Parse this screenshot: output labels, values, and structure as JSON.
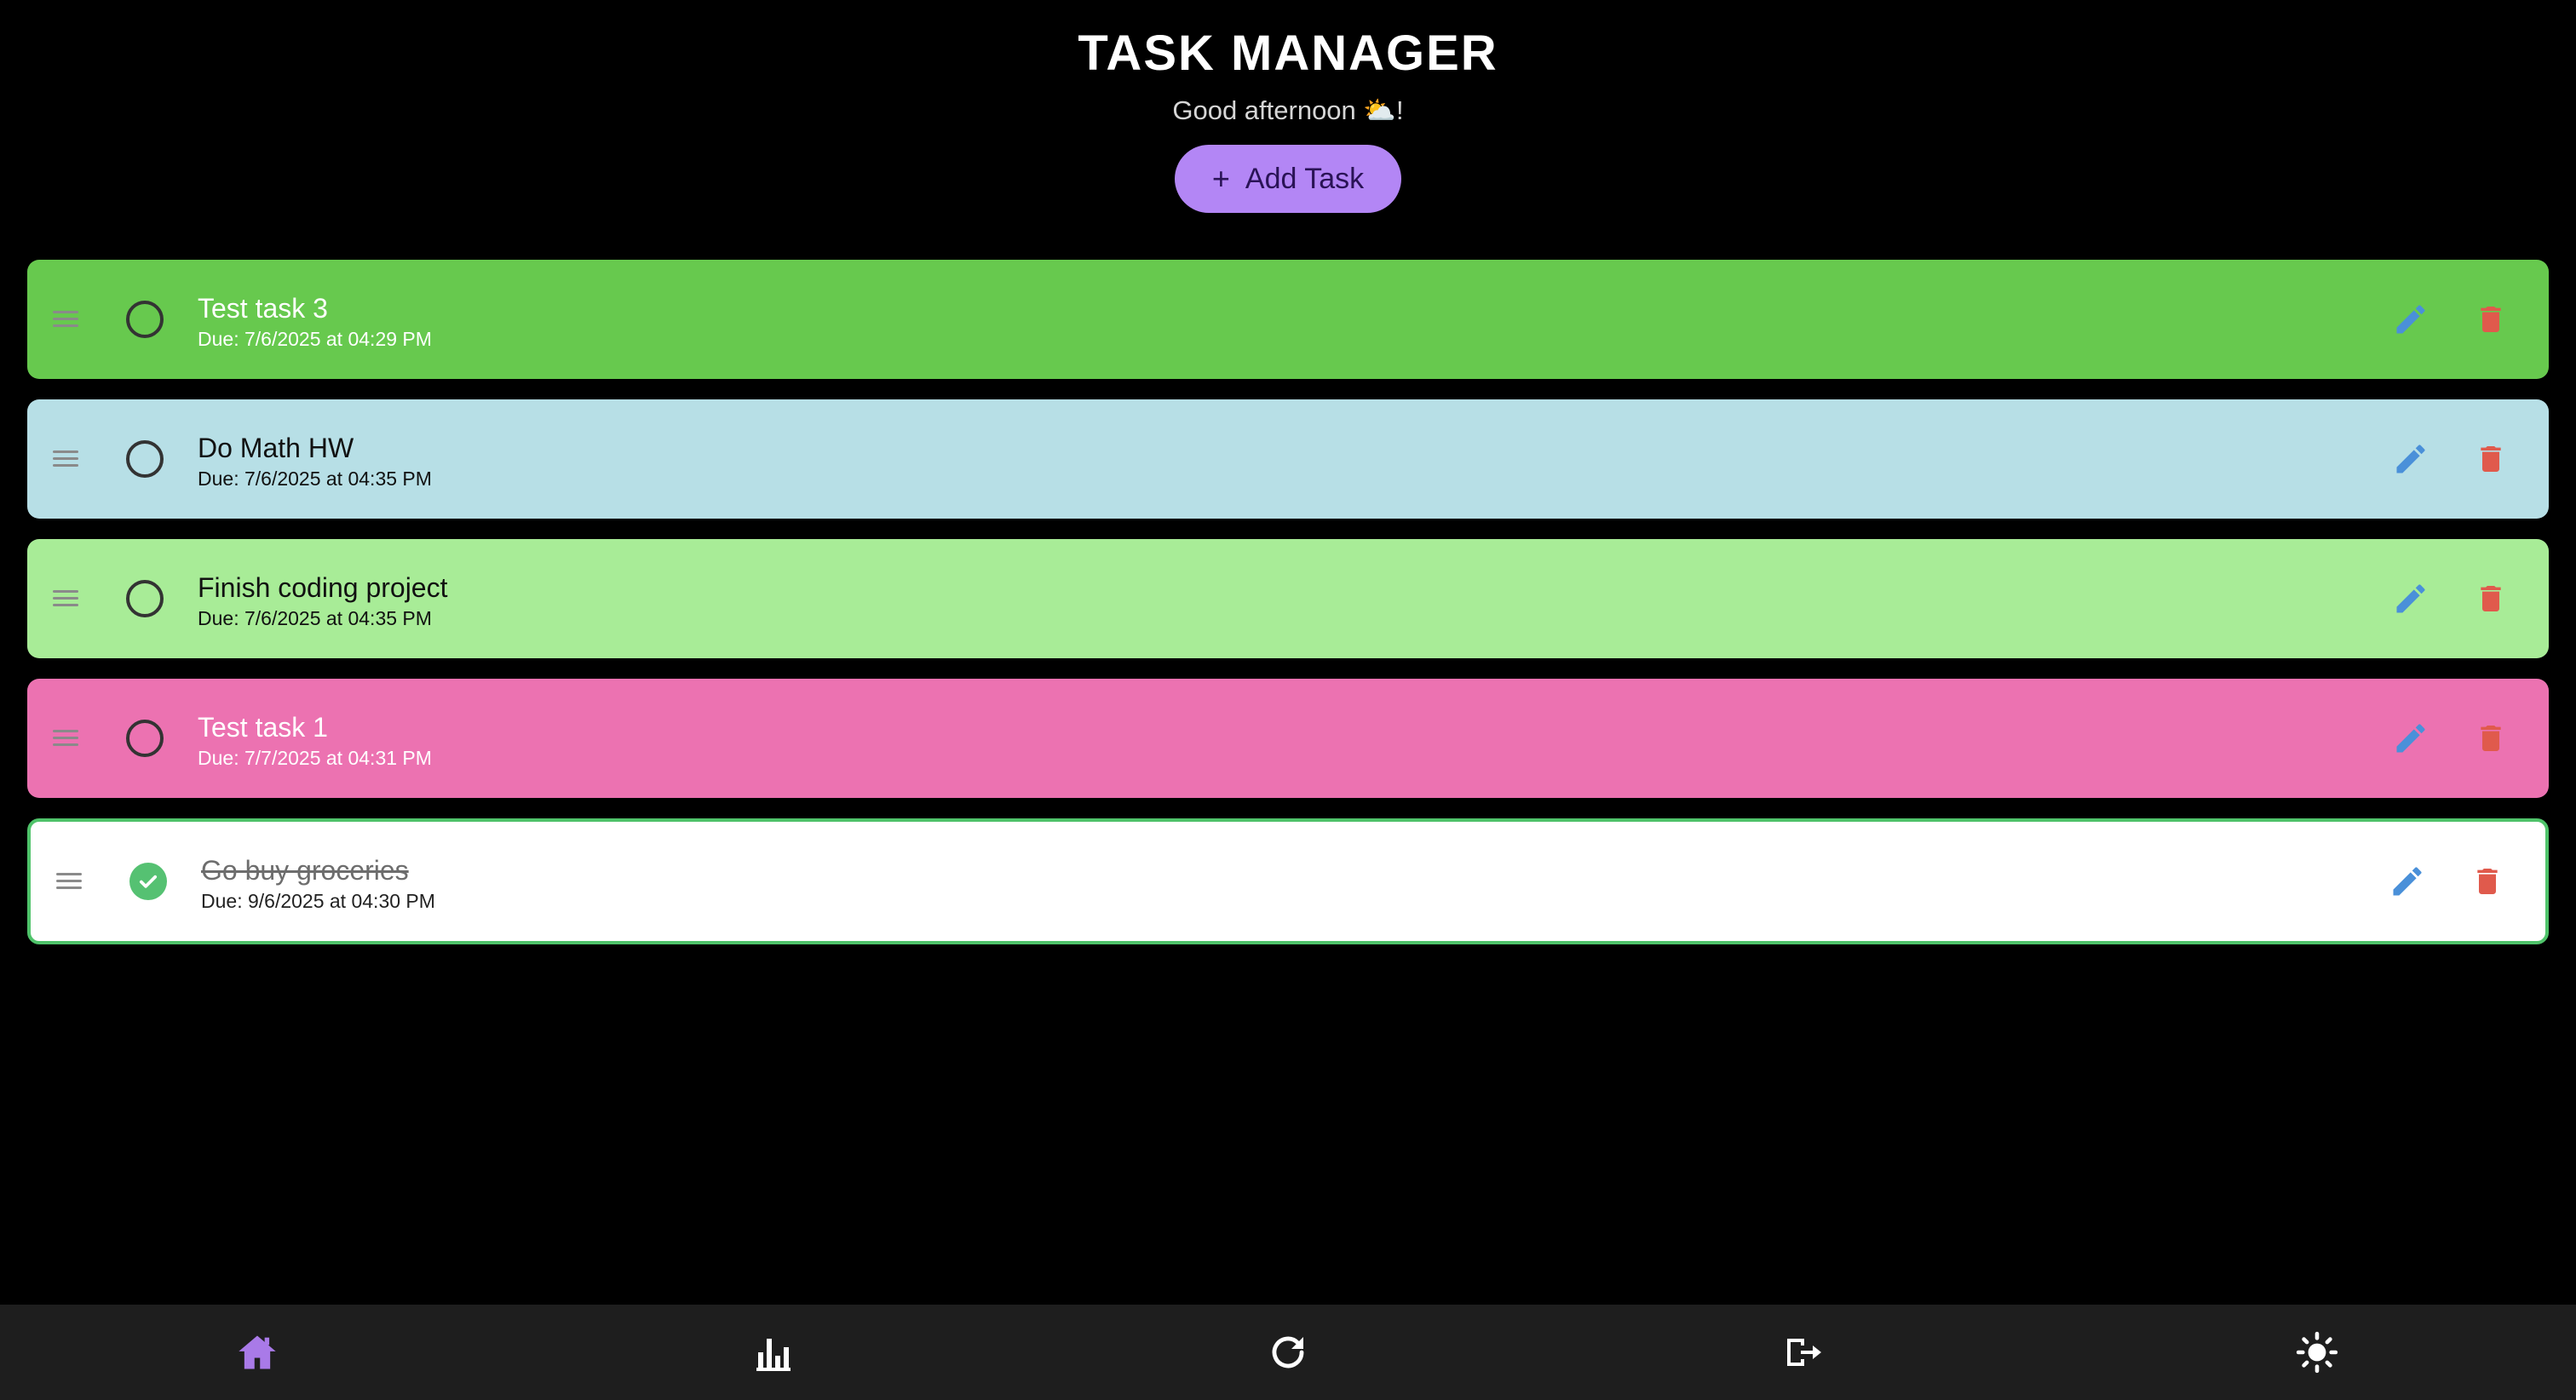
{
  "header": {
    "title": "TASK MANAGER",
    "greeting_prefix": "Good afternoon ",
    "greeting_emoji": "⛅",
    "greeting_suffix": "!",
    "add_button_icon": "+",
    "add_button_label": "Add Task"
  },
  "tasks": [
    {
      "title": "Test task 3",
      "due": "Due: 7/6/2025 at 04:29 PM",
      "color": "#67c94e",
      "text_color": "#ffffff",
      "completed": false
    },
    {
      "title": "Do Math HW",
      "due": "Due: 7/6/2025 at 04:35 PM",
      "color": "#b7dfe6",
      "text_color": "#111111",
      "completed": false
    },
    {
      "title": "Finish coding project",
      "due": "Due: 7/6/2025 at 04:35 PM",
      "color": "#a8ec97",
      "text_color": "#111111",
      "completed": false
    },
    {
      "title": "Test task 1",
      "due": "Due: 7/7/2025 at 04:31 PM",
      "color": "#ec72b1",
      "text_color": "#ffffff",
      "completed": false
    },
    {
      "title": "Go buy groceries",
      "due": "Due: 9/6/2025 at 04:30 PM",
      "color": "#ffffff",
      "text_color": "#222222",
      "completed": true
    }
  ],
  "task_icons": {
    "drag": "drag-handle-icon",
    "edit": "pencil-icon",
    "delete": "trash-icon",
    "edit_color": "#4a90d9",
    "delete_color": "#e05a4c"
  },
  "bottom_nav": [
    {
      "name": "home-icon",
      "active": true,
      "color": "#a97ae8"
    },
    {
      "name": "chart-icon",
      "active": false,
      "color": "#ffffff"
    },
    {
      "name": "refresh-icon",
      "active": false,
      "color": "#ffffff"
    },
    {
      "name": "logout-icon",
      "active": false,
      "color": "#ffffff"
    },
    {
      "name": "sun-icon",
      "active": false,
      "color": "#ffffff"
    }
  ]
}
